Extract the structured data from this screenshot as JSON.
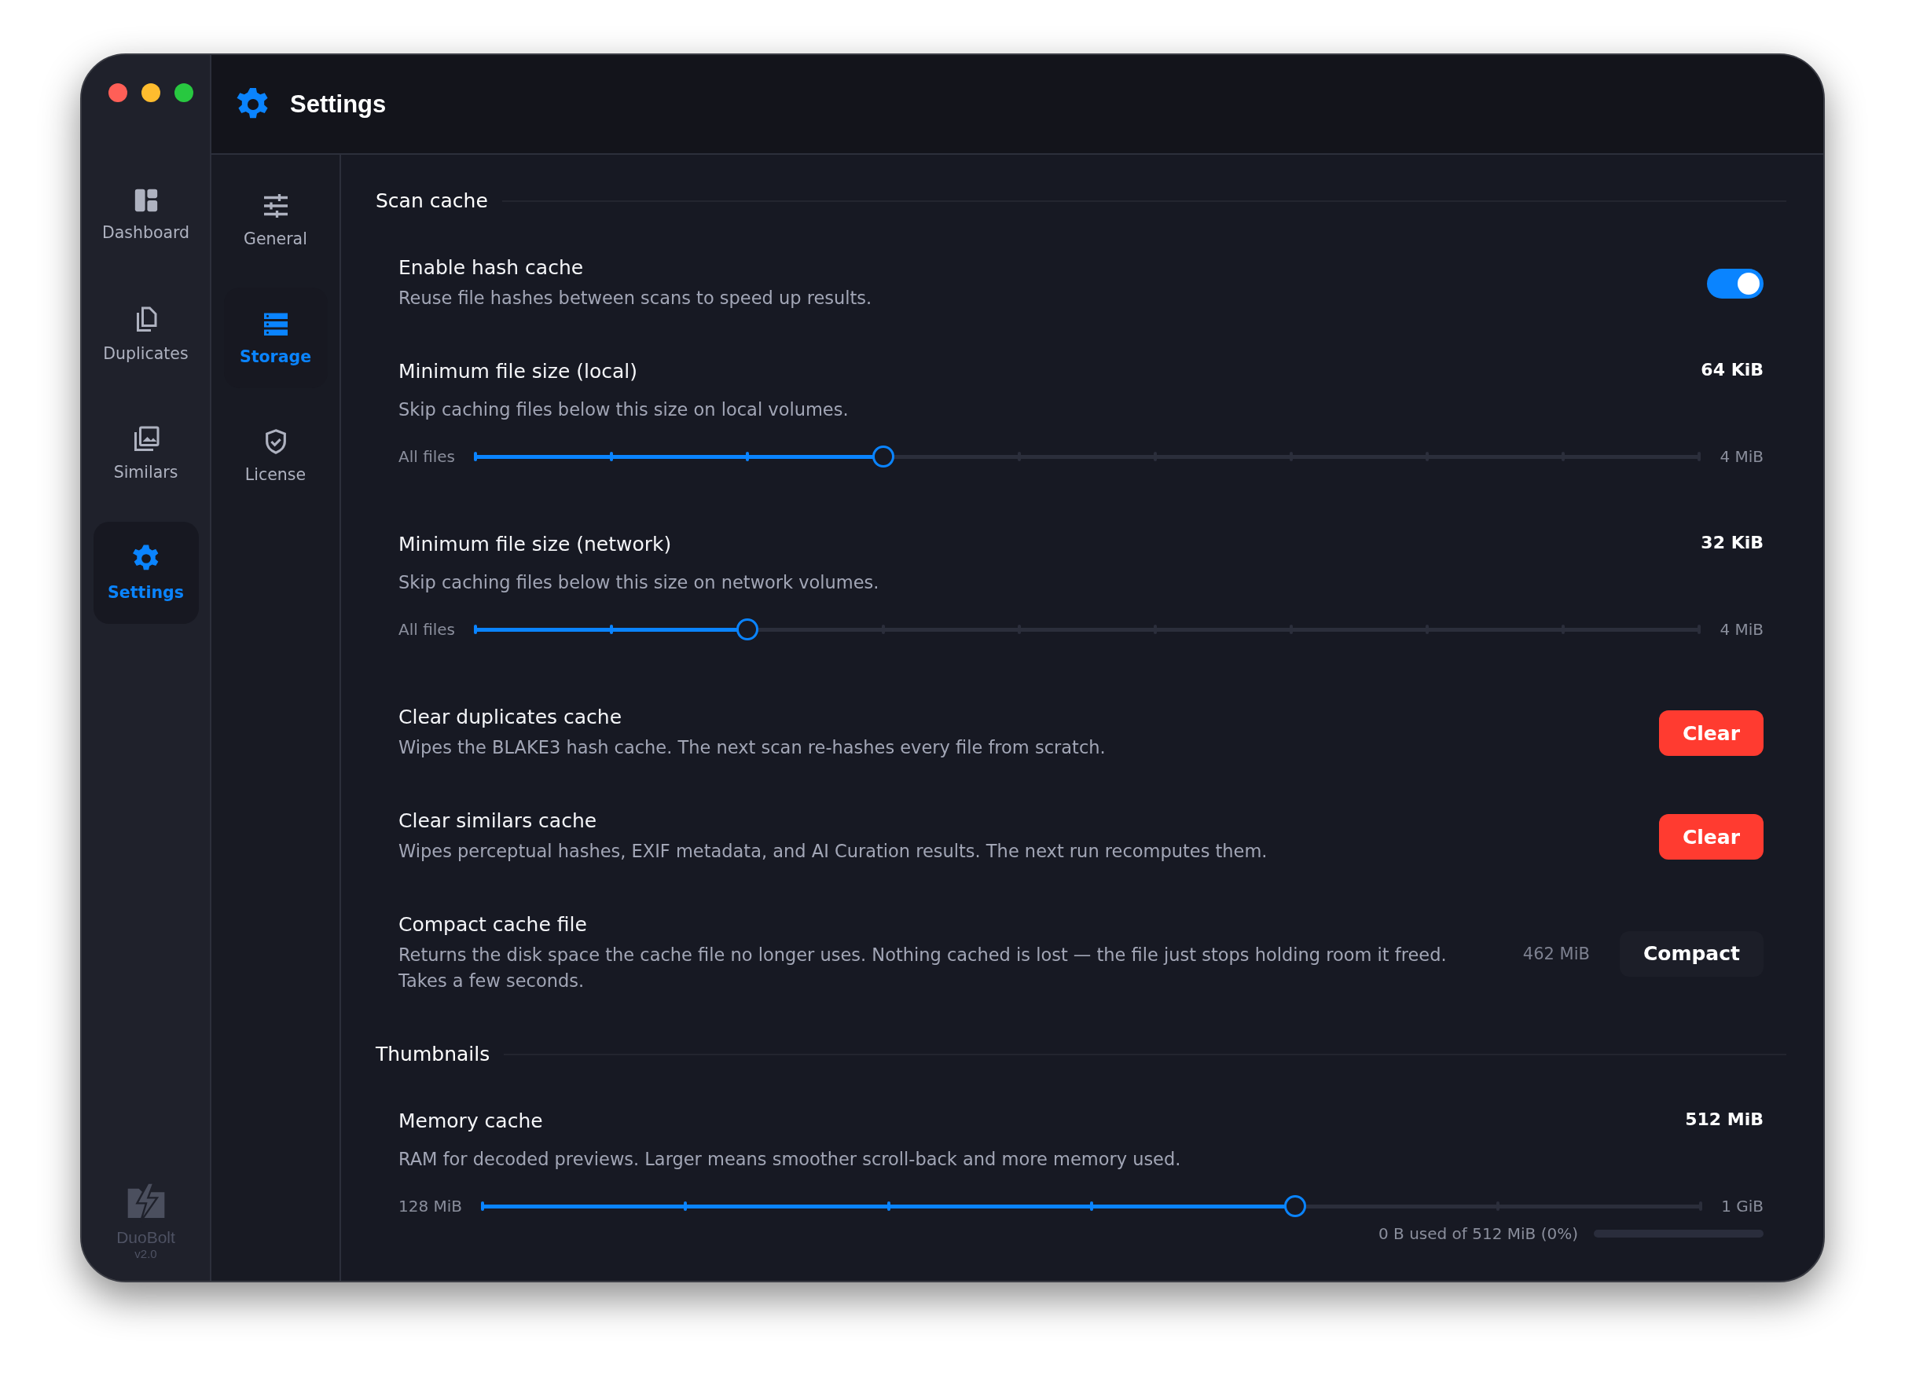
{
  "header": {
    "title": "Settings"
  },
  "sidebar": {
    "items": [
      {
        "label": "Dashboard",
        "selected": false
      },
      {
        "label": "Duplicates",
        "selected": false
      },
      {
        "label": "Similars",
        "selected": false
      },
      {
        "label": "Settings",
        "selected": true
      }
    ],
    "brand": {
      "name": "DuoBolt",
      "version": "v2.0"
    }
  },
  "subnav": {
    "items": [
      {
        "label": "General",
        "selected": false
      },
      {
        "label": "Storage",
        "selected": true
      },
      {
        "label": "License",
        "selected": false
      }
    ]
  },
  "sections": [
    {
      "title": "Scan cache",
      "rows": [
        {
          "kind": "toggle",
          "title": "Enable hash cache",
          "description": "Reuse file hashes between scans to speed up results.",
          "on": true
        },
        {
          "kind": "slider",
          "title": "Minimum file size (local)",
          "description": "Skip caching files below this size on local volumes.",
          "value": "64 KiB",
          "min_label": "All files",
          "max_label": "4 MiB",
          "level": 0.3333
        },
        {
          "kind": "slider",
          "title": "Minimum file size (network)",
          "description": "Skip caching files below this size on network volumes.",
          "value": "32 KiB",
          "min_label": "All files",
          "max_label": "4 MiB",
          "level": 0.2222
        },
        {
          "kind": "action",
          "title": "Clear duplicates cache",
          "description": "Wipes the BLAKE3 hash cache. The next scan re-hashes every file from scratch.",
          "button": {
            "label": "Clear",
            "kind": "danger"
          }
        },
        {
          "kind": "action",
          "title": "Clear similars cache",
          "description": "Wipes perceptual hashes, EXIF metadata, and AI Curation results. The next run recomputes them.",
          "button": {
            "label": "Clear",
            "kind": "danger"
          }
        },
        {
          "kind": "action",
          "title": "Compact cache file",
          "description": "Returns the disk space the cache file no longer uses. Nothing cached is lost — the file just stops holding room it freed. Takes a few seconds.",
          "reading": "462 MiB",
          "button": {
            "label": "Compact",
            "kind": "plain"
          }
        }
      ]
    },
    {
      "title": "Thumbnails",
      "rows": [
        {
          "kind": "slider",
          "title": "Memory cache",
          "description": "RAM for decoded previews. Larger means smoother scroll-back and more memory used.",
          "value": "512 MiB",
          "min_label": "128 MiB",
          "max_label": "1 GiB",
          "level": 0.6667,
          "usage": {
            "text": "0 B used of 512 MiB (0%)",
            "level": 0
          }
        }
      ]
    }
  ]
}
